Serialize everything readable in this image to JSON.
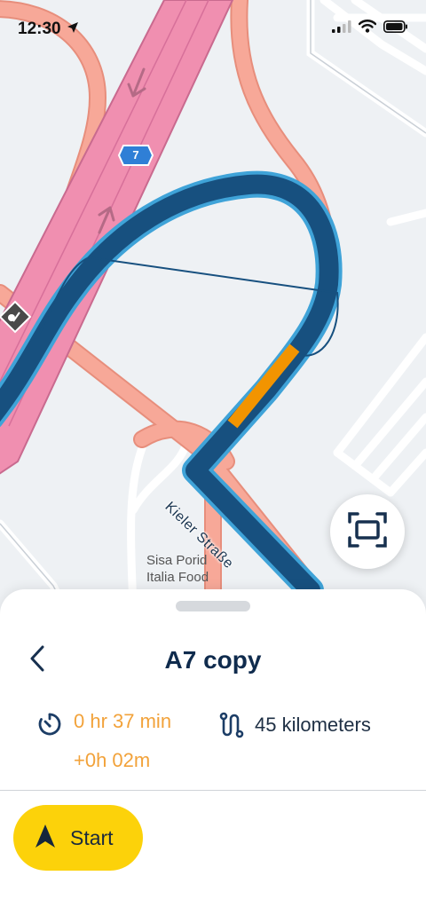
{
  "status_bar": {
    "time": "12:30"
  },
  "map": {
    "road_shield": "7",
    "street_label": "Kieler Straße",
    "place_label_line1": "Sisa Porid",
    "place_label_line2": "Italia Food"
  },
  "route": {
    "title": "A7 copy",
    "duration": "0 hr 37 min",
    "delay": "+0h 02m",
    "distance": "45 kilometers"
  },
  "actions": {
    "start_label": "Start"
  },
  "colors": {
    "route": "#1a5c8c",
    "traffic": "#f29400",
    "highway": "#f08fb0",
    "road": "#f7a898",
    "accent": "#fcd20a",
    "delay": "#f2a23a"
  },
  "icons": [
    "location-arrow-icon",
    "signal-icon",
    "wifi-icon",
    "battery-icon",
    "fit-route-icon",
    "back-chevron-icon",
    "timer-icon",
    "route-distance-icon",
    "navigation-arrow-icon",
    "toll-icon"
  ]
}
